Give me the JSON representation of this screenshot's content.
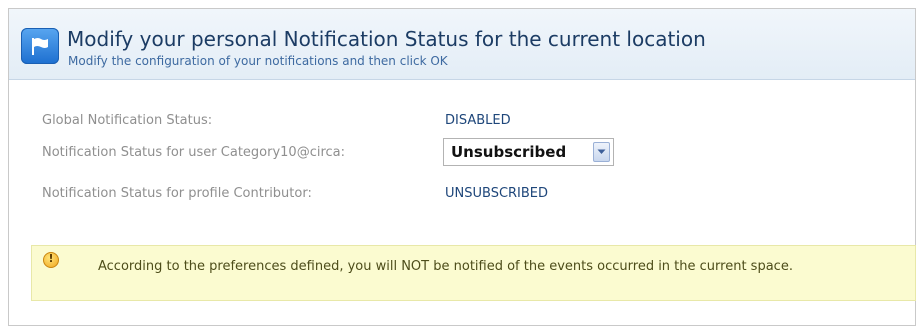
{
  "header": {
    "title": "Modify your personal Notification Status for the current location",
    "subtitle": "Modify the configuration of your notifications and then click OK",
    "icon": "flag-icon"
  },
  "fields": [
    {
      "label": "Global Notification Status:",
      "value": "DISABLED"
    },
    {
      "label": "Notification Status for user Category10@circa:",
      "value": "Unsubscribed"
    },
    {
      "label": "Notification Status for profile Contributor:",
      "value": "UNSUBSCRIBED"
    }
  ],
  "warning": {
    "icon": "warning-icon",
    "text": "According to the preferences defined, you will NOT be notified of the events occurred in the current space."
  },
  "colors": {
    "header_bg": "#e3edf6",
    "title": "#1c3c64",
    "value": "#1e467a",
    "warning_bg": "#fbfbd0"
  }
}
